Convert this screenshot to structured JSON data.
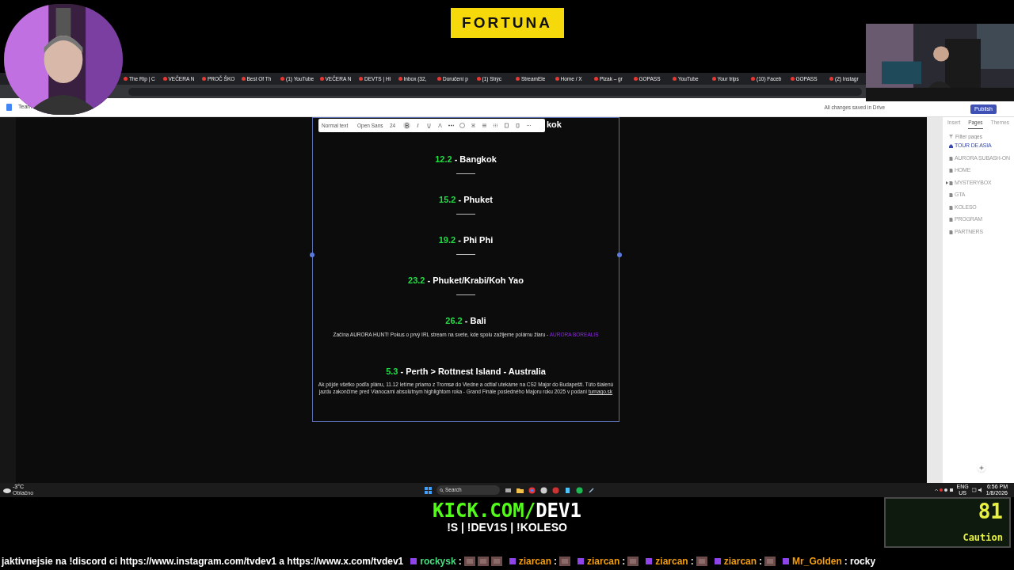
{
  "logo": "FORTUNA",
  "browser": {
    "tabs": [
      {
        "label": "The Rip | C"
      },
      {
        "label": "VEČERA N"
      },
      {
        "label": "PROČ ŠKO"
      },
      {
        "label": "Best Of Th"
      },
      {
        "label": "(1) YouTube"
      },
      {
        "label": "VEČERA N"
      },
      {
        "label": "DEVTS | Hi"
      },
      {
        "label": "Inbox (32,"
      },
      {
        "label": "Doručení p"
      },
      {
        "label": "(1) Strýc"
      },
      {
        "label": "StreamEle"
      },
      {
        "label": "Home / X"
      },
      {
        "label": "Pizak – gr"
      },
      {
        "label": "GOPASS"
      },
      {
        "label": "YouTube"
      },
      {
        "label": "Your trips"
      },
      {
        "label": "(10) Faceb"
      },
      {
        "label": "GOPASS"
      },
      {
        "label": "(2) Instagr"
      }
    ]
  },
  "app_bar": {
    "title": "Team",
    "save_status": "All changes saved in Drive",
    "publish": "Publish"
  },
  "format_toolbar": {
    "style": "Normal text",
    "font": "Open Sans",
    "size": "24",
    "bold": true
  },
  "content": {
    "cut_heading": "kok",
    "entries": [
      {
        "date": "12.2",
        "place": "- Bangkok",
        "divider": true
      },
      {
        "date": "15.2",
        "place": "- Phuket",
        "divider": true
      },
      {
        "date": "19.2",
        "place": "- Phi Phi",
        "divider": true
      },
      {
        "date": "23.2",
        "place": "- Phuket/Krabi/Koh Yao",
        "divider": true
      },
      {
        "date": "26.2",
        "place": "- Bali",
        "divider": false,
        "note": "Začína AURORA HUNT! Pokus o prvý IRL stream na svete, kde spolu zažijeme polárnu žiaru -",
        "link": "AURORA BOREALIS"
      },
      {
        "date": "5.3",
        "place": "- Perth > Rottnest Island - Australia",
        "divider": false,
        "note": "Ak pôjde všetko podľa plánu, 11.12 letíme priamo z Tromsø do Viedne a odtiaľ utekáme na CS2 Major do Budapešti. Túto šialenú jazdu zakončíme pred Vianocami absolútnym highlightom roka - Grand Finále posledného Majoru roku 2025 v podaní",
        "link": "turnago.sk"
      }
    ]
  },
  "sidebar": {
    "tabs": [
      {
        "label": "Insert",
        "selected": false
      },
      {
        "label": "Pages",
        "selected": true
      },
      {
        "label": "Themes",
        "selected": false
      }
    ],
    "filter": {
      "placeholder": "Filter pages"
    },
    "pages": [
      {
        "label": "TOUR DE ASIA",
        "kind": "home",
        "selected": true
      },
      {
        "label": "AURORA SUBASH-ON",
        "kind": "page",
        "selected": false
      },
      {
        "label": "HOME",
        "kind": "page",
        "selected": false
      },
      {
        "label": "MYSTERYBOX",
        "kind": "folder",
        "selected": false,
        "expanded": false
      },
      {
        "label": "GTA",
        "kind": "page",
        "selected": false
      },
      {
        "label": "KOLESO",
        "kind": "page",
        "selected": false
      },
      {
        "label": "PROGRAM",
        "kind": "page",
        "selected": false
      },
      {
        "label": "PARTNERS",
        "kind": "page",
        "selected": false
      }
    ]
  },
  "taskbar": {
    "temperature": "-3°C",
    "weather": "Oblačno",
    "search": "Search",
    "lang": "ENG",
    "region": "US",
    "time": "6:56 PM",
    "date": "1/8/2026"
  },
  "overlay": {
    "kick_domain": "KICK.COM/",
    "kick_channel": "DEV1",
    "commands": "!S | !DEV1S | !KOLESO",
    "meter": "81",
    "meter_label": "Caution"
  },
  "ticker": {
    "message": "jaktivnejsie na !discord ci https://www.instagram.com/tvdev1 a https://www.x.com/tvdev1",
    "chat": [
      {
        "user": "rockysk",
        "color": "#4ade80",
        "text": ":",
        "emotes": [
          {
            "kind": "emote"
          },
          {
            "kind": "emote"
          },
          {
            "kind": "emote"
          }
        ]
      },
      {
        "user": "ziarcan",
        "color": "#f59e0b",
        "text": ":",
        "emotes": [
          {
            "kind": "emote"
          }
        ]
      },
      {
        "user": "ziarcan",
        "color": "#f59e0b",
        "text": ":",
        "emotes": [
          {
            "kind": "emote"
          }
        ]
      },
      {
        "user": "ziarcan",
        "color": "#f59e0b",
        "text": ":",
        "emotes": [
          {
            "kind": "emote"
          }
        ]
      },
      {
        "user": "ziarcan",
        "color": "#f59e0b",
        "text": ":",
        "emotes": [
          {
            "kind": "emote"
          }
        ]
      },
      {
        "user": "Mr_Golden",
        "color": "#f59e0b",
        "text": ": rocky"
      }
    ]
  }
}
